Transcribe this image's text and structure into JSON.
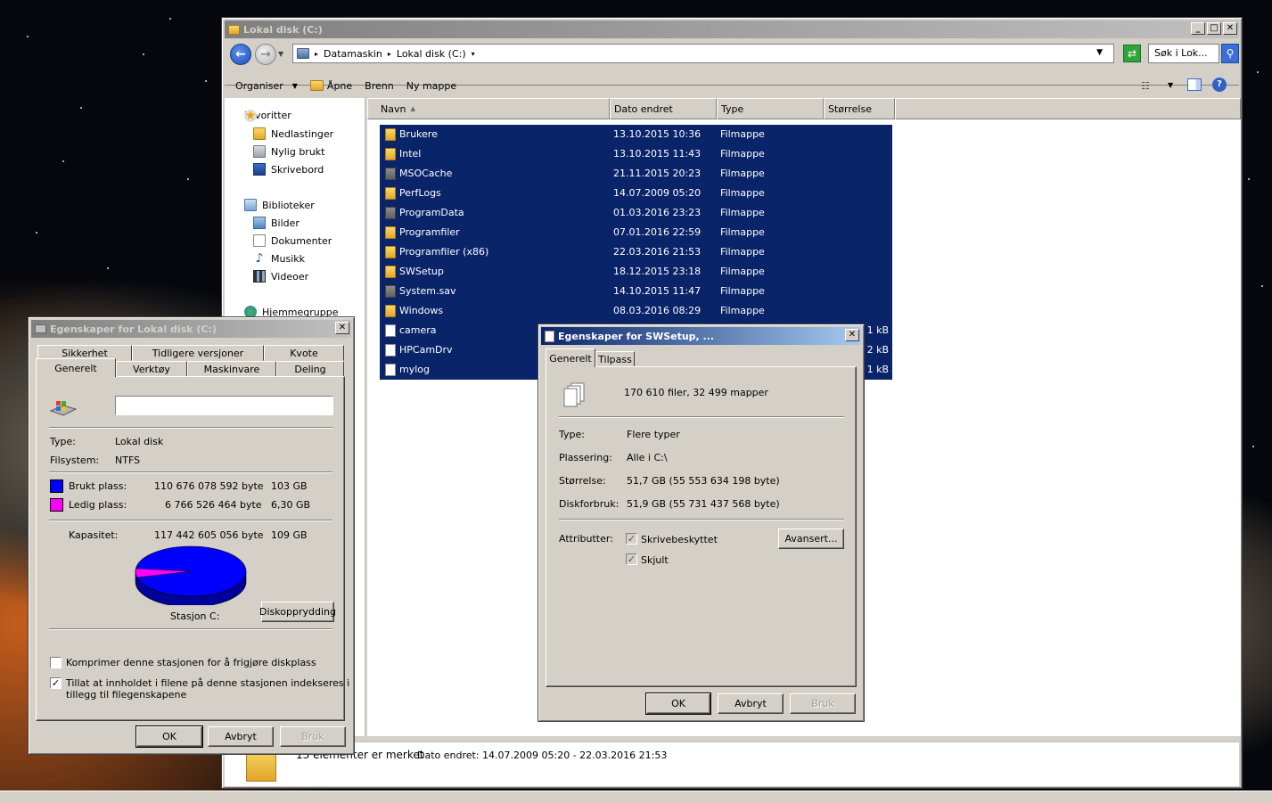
{
  "explorer": {
    "title": "Lokal disk (C:)",
    "breadcrumbs": [
      "Datamaskin",
      "Lokal disk (C:)"
    ],
    "search_placeholder": "Søk i Lok...",
    "commands": {
      "organize": "Organiser",
      "open": "Åpne",
      "burn": "Brenn",
      "new_folder": "Ny mappe"
    },
    "nav": {
      "favorites": "Favoritter",
      "downloads": "Nedlastinger",
      "recent": "Nylig brukt",
      "desktop": "Skrivebord",
      "libraries": "Biblioteker",
      "pictures": "Bilder",
      "documents": "Dokumenter",
      "music": "Musikk",
      "videos": "Videoer",
      "homegroup": "Hjemmegruppe"
    },
    "columns": {
      "name": "Navn",
      "date": "Dato endret",
      "type": "Type",
      "size": "Størrelse"
    },
    "files": [
      {
        "name": "Brukere",
        "date": "13.10.2015 10:36",
        "type": "Filmappe",
        "size": "",
        "kind": "folder"
      },
      {
        "name": "Intel",
        "date": "13.10.2015 11:43",
        "type": "Filmappe",
        "size": "",
        "kind": "folder"
      },
      {
        "name": "MSOCache",
        "date": "21.11.2015 20:23",
        "type": "Filmappe",
        "size": "",
        "kind": "hidden"
      },
      {
        "name": "PerfLogs",
        "date": "14.07.2009 05:20",
        "type": "Filmappe",
        "size": "",
        "kind": "folder"
      },
      {
        "name": "ProgramData",
        "date": "01.03.2016 23:23",
        "type": "Filmappe",
        "size": "",
        "kind": "hidden"
      },
      {
        "name": "Programfiler",
        "date": "07.01.2016 22:59",
        "type": "Filmappe",
        "size": "",
        "kind": "folder"
      },
      {
        "name": "Programfiler (x86)",
        "date": "22.03.2016 21:53",
        "type": "Filmappe",
        "size": "",
        "kind": "folder"
      },
      {
        "name": "SWSetup",
        "date": "18.12.2015 23:18",
        "type": "Filmappe",
        "size": "",
        "kind": "folder"
      },
      {
        "name": "System.sav",
        "date": "14.10.2015 11:47",
        "type": "Filmappe",
        "size": "",
        "kind": "hidden"
      },
      {
        "name": "Windows",
        "date": "08.03.2016 08:29",
        "type": "Filmappe",
        "size": "",
        "kind": "folder"
      },
      {
        "name": "camera",
        "date": "",
        "type": "",
        "size": "1 kB",
        "kind": "file"
      },
      {
        "name": "HPCamDrv",
        "date": "",
        "type": "",
        "size": "2 kB",
        "kind": "file"
      },
      {
        "name": "mylog",
        "date": "",
        "type": "",
        "size": "1 kB",
        "kind": "file"
      }
    ],
    "status": {
      "selected": "13 elementer er merket",
      "date_range": "Dato endret: 14.07.2009 05:20 - 22.03.2016 21:53"
    }
  },
  "disk_props": {
    "title": "Egenskaper for Lokal disk (C:)",
    "tabs_row1": [
      "Sikkerhet",
      "Tidligere versjoner",
      "Kvote"
    ],
    "tabs_row2": [
      "Generelt",
      "Verktøy",
      "Maskinvare",
      "Deling"
    ],
    "name_value": "",
    "type_label": "Type:",
    "type_value": "Lokal disk",
    "fs_label": "Filsystem:",
    "fs_value": "NTFS",
    "used_label": "Brukt plass:",
    "used_bytes": "110 676 078 592 byte",
    "used_gb": "103 GB",
    "free_label": "Ledig plass:",
    "free_bytes": "6 766 526 464 byte",
    "free_gb": "6,30 GB",
    "capacity_label": "Kapasitet:",
    "capacity_bytes": "117 442 605 056 byte",
    "capacity_gb": "109 GB",
    "used_fraction": 0.942,
    "used_color": "#0000ff",
    "free_color": "#ff00ff",
    "drive_label": "Stasjon C:",
    "cleanup": "Diskopprydding",
    "compress": "Komprimer denne stasjonen for å frigjøre diskplass",
    "index": "Tillat at innholdet i filene på denne stasjonen indekseres i",
    "index_line2": "tillegg til filegenskapene",
    "ok": "OK",
    "cancel": "Avbryt",
    "apply": "Bruk"
  },
  "sw_props": {
    "title": "Egenskaper for SWSetup, ...",
    "tabs": [
      "Generelt",
      "Tilpass"
    ],
    "summary": "170 610 filer, 32 499 mapper",
    "type_label": "Type:",
    "type_value": "Flere typer",
    "location_label": "Plassering:",
    "location_value": "Alle i C:\\",
    "size_label": "Størrelse:",
    "size_value": "51,7 GB (55 553 634 198 byte)",
    "disk_label": "Diskforbruk:",
    "disk_value": "51,9 GB (55 731 437 568 byte)",
    "attr_label": "Attributter:",
    "readonly": "Skrivebeskyttet",
    "hidden": "Skjult",
    "advanced": "Avansert...",
    "ok": "OK",
    "cancel": "Avbryt",
    "apply": "Bruk"
  }
}
